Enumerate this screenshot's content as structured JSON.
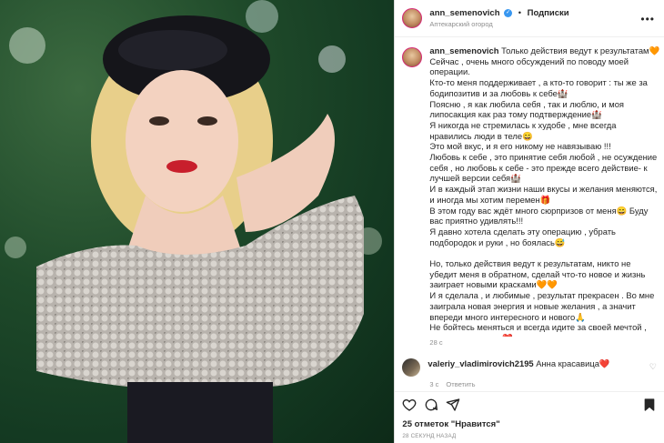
{
  "post": {
    "author": "ann_semenovich",
    "verified_mark": "✓",
    "follow_label": "Подписки",
    "location": "Аптекарский огород",
    "more_label": "•••"
  },
  "caption": {
    "username": "ann_semenovich",
    "text": "Только действия ведут к результатам🧡\nСейчас , очень много обсуждений по поводу моей операции.\nКто-то меня поддерживает , а кто-то говорит : ты же за бодипозитив и за любовь к себе🏰\nПоясню , я как любила себя , так и люблю, и моя липосакция как раз тому подтверждение🏰\nЯ никогда не стремилась к худобе , мне всегда нравились люди в теле😄\nЭто мой вкус, и я его никому не навязываю !!!\nЛюбовь к себе , это принятие себя любой , не осуждение себя , но любовь к себе - это прежде всего действие- к лучшей версии себя🏰\nИ в каждый этап жизни наши вкусы и желания меняются, и иногда мы хотим перемен🎁\nВ этом году вас ждёт много сюрпризов от меня😄 Буду вас приятно удивлять!!!\nЯ давно хотела сделать эту операцию , убрать подбородок и руки , но боялась😅\n\nНо, только действия ведут к результатам, никто не убедит меня в обратном, сделай что-то новое и жизнь заиграет новыми красками🧡🧡\nИ я сделала , и любимые , результат прекрасен . Во мне заиграла новая энергия и новые желания , а значит впереди много интересного и нового🙏\nНе бойтесь меняться и всегда идите за своей мечтой , это очень приятно❤️\n#аниныистории",
    "time": "28 с"
  },
  "comment": {
    "username": "valeriy_vladimirovich2195",
    "text": "Анна красавица❤️",
    "time": "3 с",
    "reply_label": "Ответить"
  },
  "likes": "25 отметок \"Нравится\"",
  "posted_ago": "28 СЕКУНД НАЗАД",
  "colors": {
    "accent": "#3897f0",
    "ring": "#d62976",
    "muted": "#8e8e8e",
    "background": "#0d2a18"
  },
  "icons": [
    "heart-icon",
    "comment-icon",
    "share-icon",
    "bookmark-icon",
    "more-icon",
    "like-comment-icon"
  ]
}
